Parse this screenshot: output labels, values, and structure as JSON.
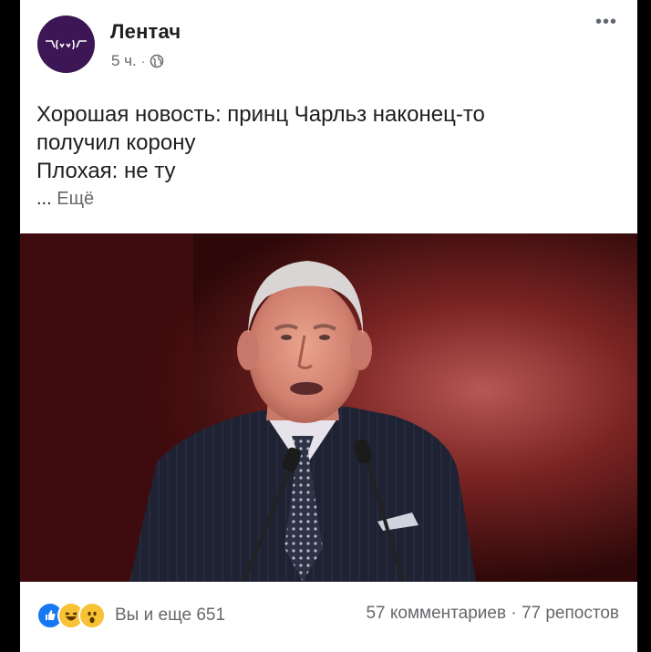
{
  "post": {
    "author": "Лентач",
    "time": "5 ч.",
    "separator": "·",
    "menu_icon": "more-dots-icon",
    "privacy_icon": "globe-icon",
    "lines": [
      "Хорошая новость: принц Чарльз наконец-то",
      "получил корону",
      "Плохая: не ту"
    ],
    "see_more_ellipsis": "...",
    "see_more": "Ещё"
  },
  "photo": {
    "icon": "photo-of-speaker",
    "background_color": "#6d1d1d"
  },
  "footer": {
    "reaction_icons": [
      "like-icon",
      "haha-icon",
      "wow-icon"
    ],
    "reactions_text": "Вы и еще 651",
    "comments": "57 комментариев",
    "dot": "·",
    "shares": "77 репостов"
  }
}
